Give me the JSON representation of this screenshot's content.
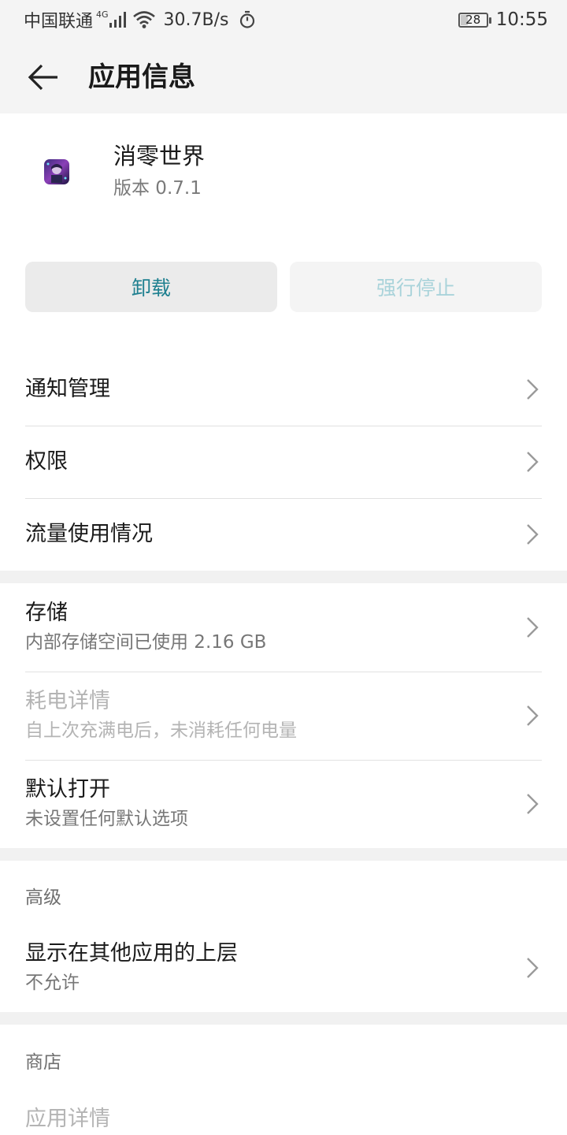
{
  "status_bar": {
    "carrier": "中国联通",
    "network": "4G",
    "speed": "30.7B/s",
    "battery": "28",
    "battery_level": 0.28,
    "time": "10:55"
  },
  "app_bar": {
    "title": "应用信息"
  },
  "app": {
    "name": "消零世界",
    "version": "版本 0.7.1"
  },
  "actions": {
    "uninstall": "卸载",
    "force_stop": "强行停止"
  },
  "menu": {
    "notification": "通知管理",
    "permissions": "权限",
    "data_usage": "流量使用情况",
    "storage": {
      "label": "存储",
      "sub": "内部存储空间已使用 2.16 GB"
    },
    "battery": {
      "label": "耗电详情",
      "sub": "自上次充满电后，未消耗任何电量"
    },
    "default_open": {
      "label": "默认打开",
      "sub": "未设置任何默认选项"
    }
  },
  "advanced": {
    "title": "高级",
    "overlay": {
      "label": "显示在其他应用的上层",
      "sub": "不允许"
    }
  },
  "store": {
    "title": "商店",
    "app_details": "应用详情"
  },
  "colors": {
    "accent": "#1f8090",
    "accent_disabled": "#a9d3da",
    "background_bar": "#f4f4f4",
    "separator": "#f1f1f1"
  }
}
